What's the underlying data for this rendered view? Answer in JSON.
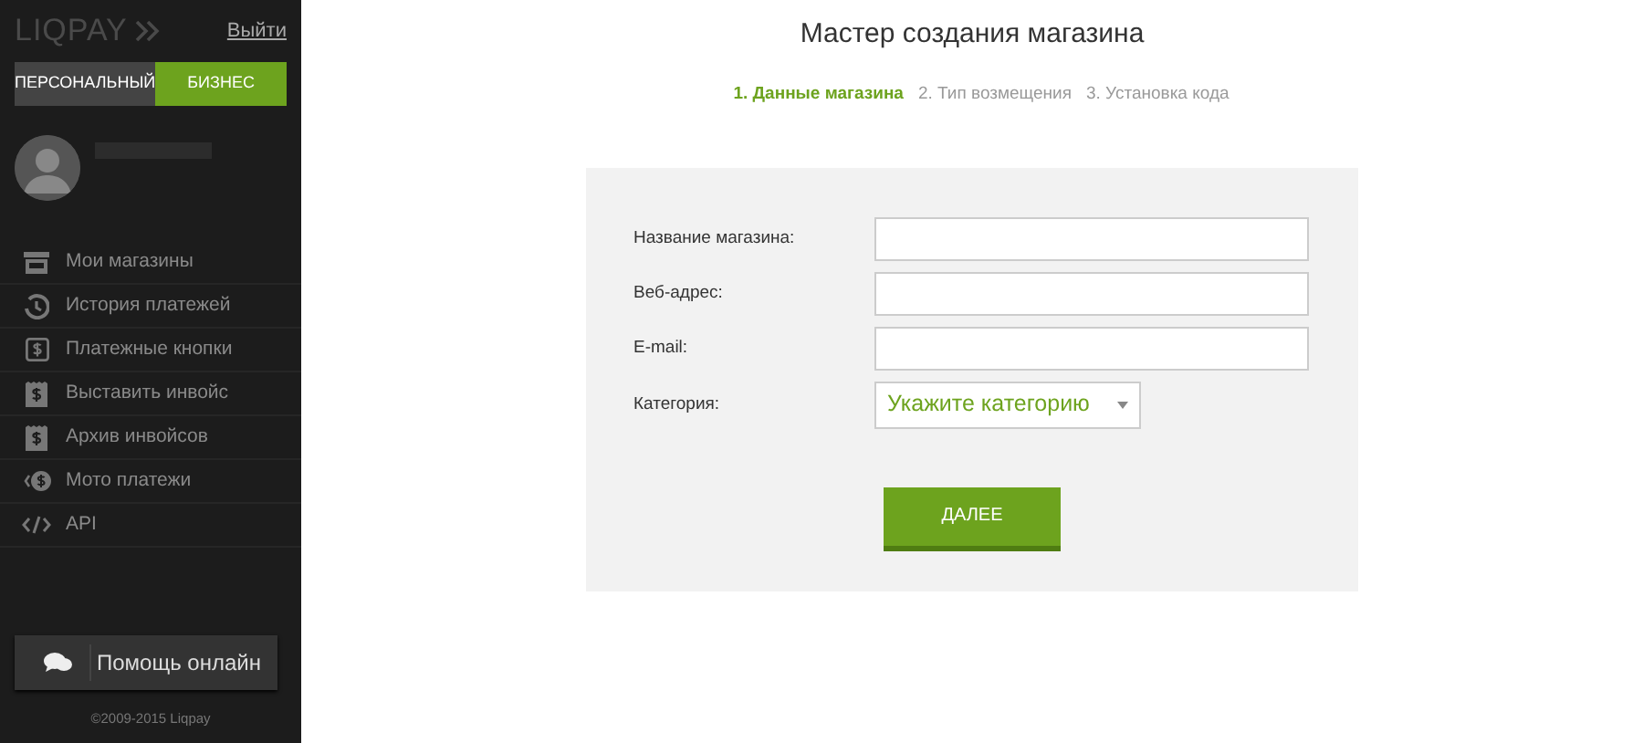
{
  "sidebar": {
    "logo": "LIQPAY",
    "logout": "Выйти",
    "modes": [
      {
        "label": "ПЕРСОНАЛЬНЫЙ",
        "selected": false
      },
      {
        "label": "БИЗНЕС",
        "selected": true
      }
    ],
    "menu": [
      {
        "label": "Мои магазины",
        "kind": "store"
      },
      {
        "label": "История платежей",
        "kind": "history"
      },
      {
        "label": "Платежные кнопки",
        "kind": "button"
      },
      {
        "label": "Выставить инвойс",
        "kind": "invoice"
      },
      {
        "label": "Архив инвойсов",
        "kind": "invoice"
      },
      {
        "label": "Мото платежи",
        "kind": "moto"
      },
      {
        "label": "API",
        "kind": "api"
      }
    ],
    "help_button": "Помощь онлайн",
    "copyright": "©2009-2015 Liqpay"
  },
  "title": "Мастер создания магазина",
  "steps": [
    {
      "label": "1. Данные магазина",
      "selected": true
    },
    {
      "label": "2. Тип возмещения",
      "selected": false
    },
    {
      "label": "3. Установка кода",
      "selected": false
    }
  ],
  "form": {
    "fields": [
      {
        "label": "Название магазина:",
        "kind": "input"
      },
      {
        "label": "Веб-адрес:",
        "kind": "input"
      },
      {
        "label": "E-mail:",
        "kind": "input"
      },
      {
        "label": "Категория:",
        "kind": "select",
        "placeholder": "Укажите категорию"
      }
    ],
    "submit": "ДАЛЕЕ"
  }
}
